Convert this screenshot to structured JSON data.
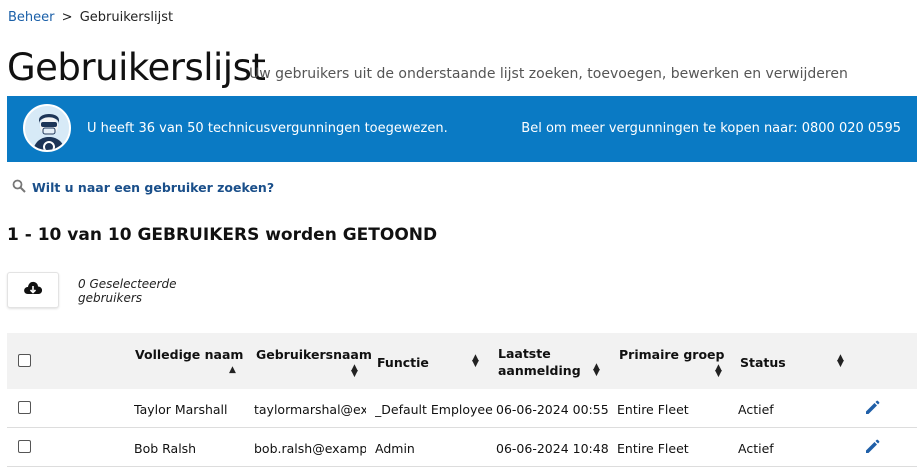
{
  "breadcrumb": {
    "parent": "Beheer",
    "separator": ">",
    "current": "Gebruikerslijst"
  },
  "page": {
    "title": "Gebruikerslijst",
    "subtitle": "Uw gebruikers uit de onderstaande lijst zoeken, toevoegen, bewerken en verwijderen"
  },
  "banner": {
    "message": "U heeft 36 van 50 technicusvergunningen toegewezen.",
    "phone_text": "Bel om meer vergunningen te kopen naar: 0800 020 0595",
    "background_color": "#0a7ac4",
    "icon": "technician-avatar-icon"
  },
  "search": {
    "label": "Wilt u naar een gebruiker zoeken?",
    "icon": "search-icon"
  },
  "summary": {
    "count_heading": "1 - 10 van 10 GEBRUIKERS worden GETOOND"
  },
  "toolbar": {
    "download_icon": "cloud-download-icon",
    "selected_line1": "0 Geselecteerde",
    "selected_line2": "gebruikers"
  },
  "table": {
    "columns": [
      {
        "label": "Volledige naam",
        "sort": "ascending"
      },
      {
        "label": "Gebruikersnaam",
        "sort": "none"
      },
      {
        "label": "Functie",
        "sort": "none"
      },
      {
        "label_line1": "Laatste",
        "label_line2": "aanmelding",
        "sort": "none"
      },
      {
        "label": "Primaire groep",
        "sort": "none"
      },
      {
        "label": "Status",
        "sort": "none"
      }
    ],
    "rows": [
      {
        "name": "Taylor Marshall",
        "username": "taylormarshal@ex…",
        "function": "_Default Employee",
        "last_login": "06-06-2024 00:55",
        "group": "Entire Fleet",
        "status": "Actief"
      },
      {
        "name": "Bob Ralsh",
        "username": "bob.ralsh@examp…",
        "function": "Admin",
        "last_login": "06-06-2024 10:48",
        "group": "Entire Fleet",
        "status": "Actief"
      }
    ],
    "edit_icon": "pencil-icon"
  }
}
